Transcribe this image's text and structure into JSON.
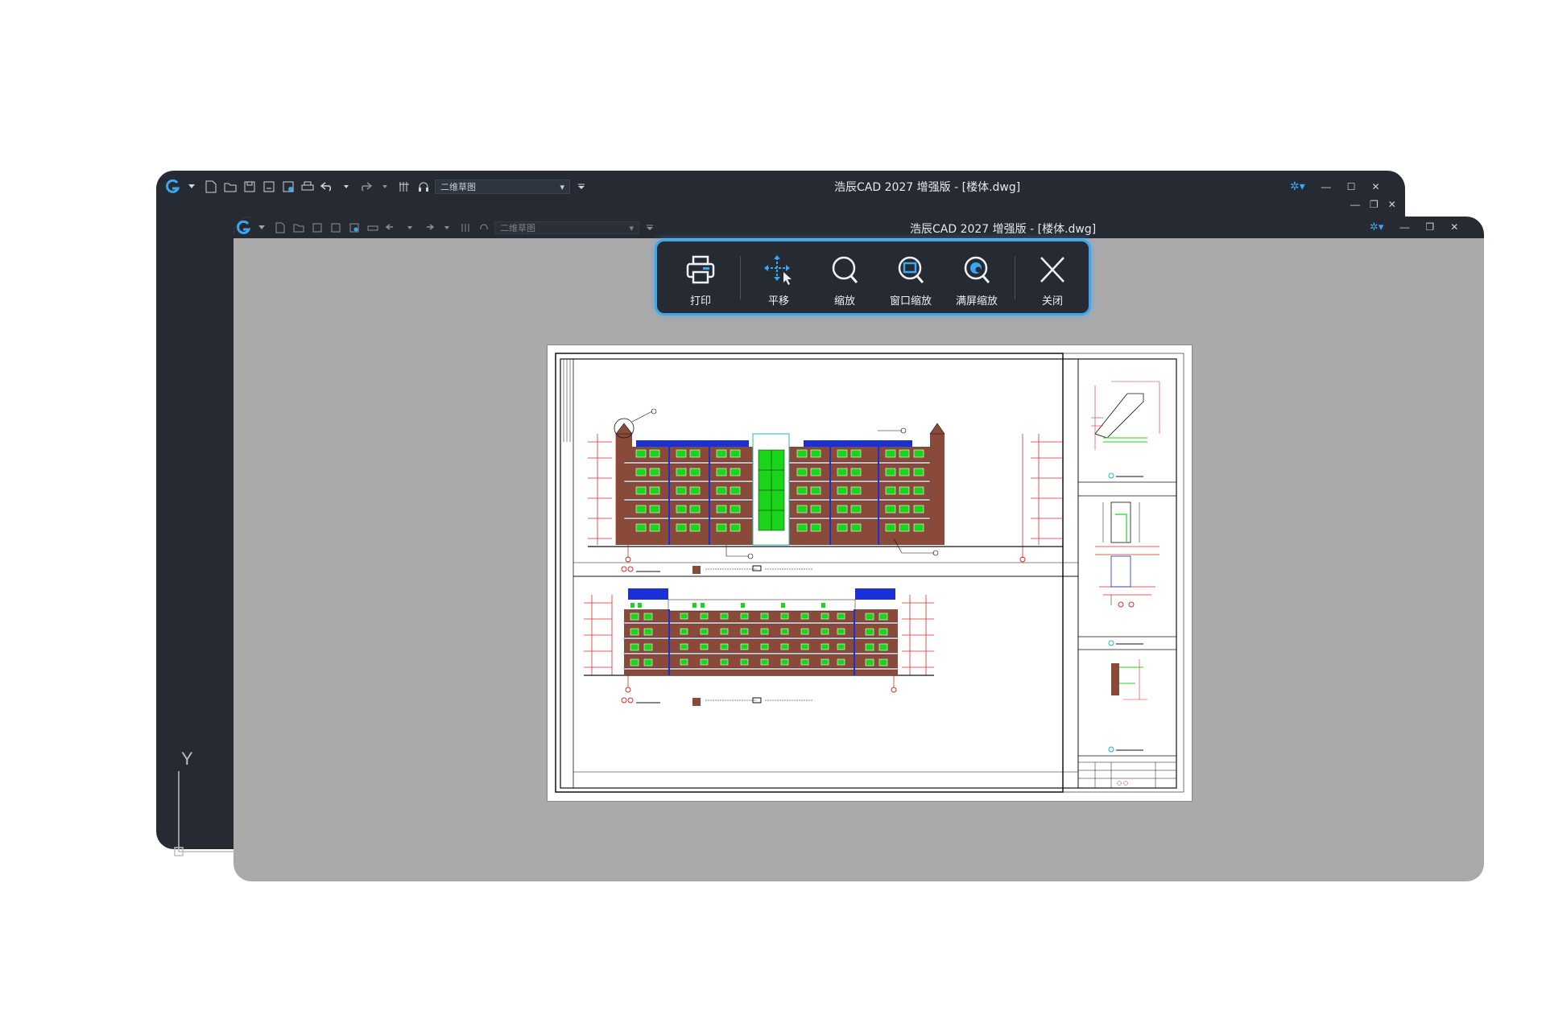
{
  "back_window": {
    "title": "浩辰CAD 2027 增强版 - [楼体.dwg]",
    "workspace": "二维草图",
    "ucs_label": "Y"
  },
  "front_window": {
    "title": "浩辰CAD 2027 增强版 - [楼体.dwg]",
    "workspace": "二维草图"
  },
  "float_toolbar": {
    "items": [
      {
        "label": "打印",
        "icon": "printer-icon"
      },
      {
        "label": "平移",
        "icon": "pan-icon"
      },
      {
        "label": "缩放",
        "icon": "zoom-icon"
      },
      {
        "label": "窗口缩放",
        "icon": "zoom-window-icon"
      },
      {
        "label": "满屏缩放",
        "icon": "zoom-extents-icon"
      },
      {
        "label": "关闭",
        "icon": "close-icon"
      }
    ]
  },
  "colors": {
    "accent": "#3ba7f0",
    "window_dark": "#252a33",
    "canvas_gray": "#aaaaaa",
    "brick": "#8a4a3a",
    "window_green": "#1bd51b",
    "roof_blue": "#1a2fd4",
    "dim_red": "#e0282a"
  }
}
